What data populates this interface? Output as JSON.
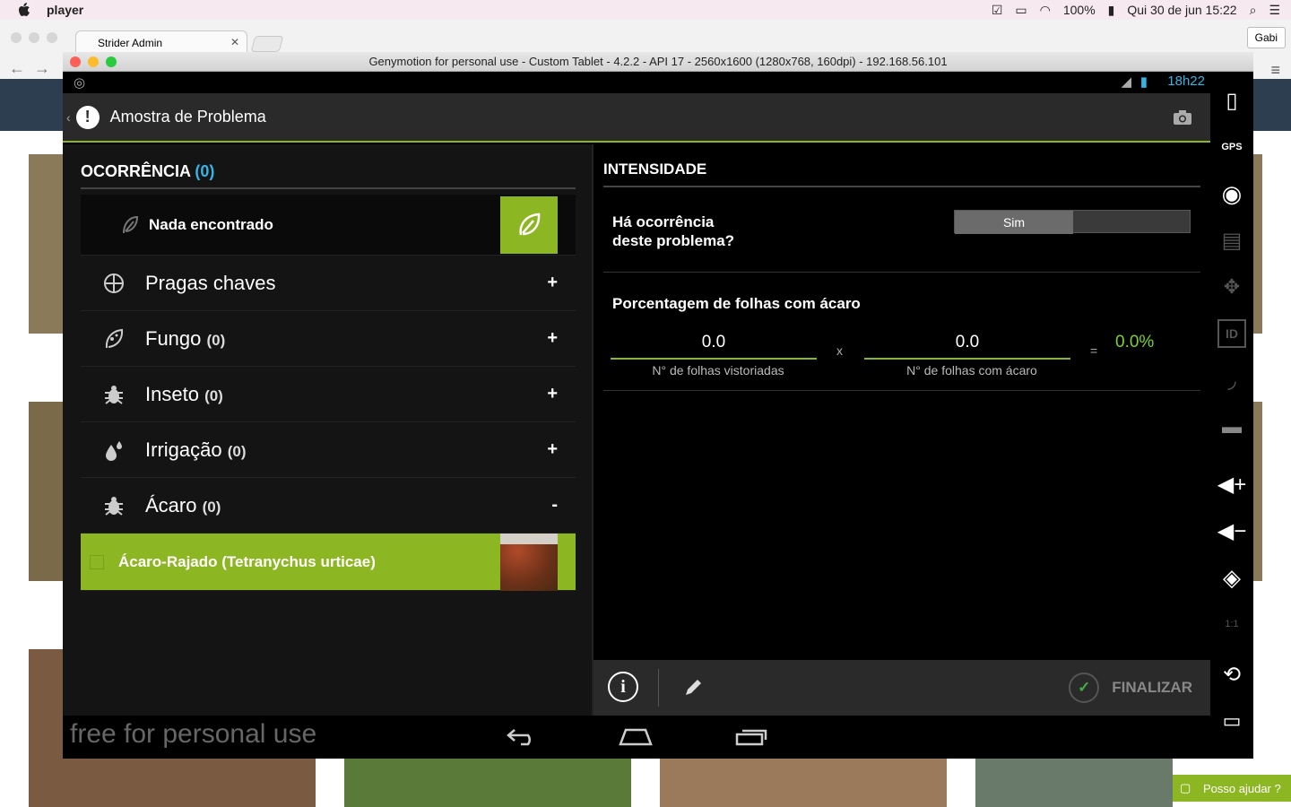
{
  "mac_menubar": {
    "app_name": "player",
    "battery": "100%",
    "datetime": "Qui 30 de jun  15:22"
  },
  "browser": {
    "tab_title": "Strider Admin",
    "profile": "Gabi"
  },
  "genymotion": {
    "title": "Genymotion for personal use - Custom Tablet - 4.2.2 - API 17 - 2560x1600 (1280x768, 160dpi) - 192.168.56.101"
  },
  "android": {
    "status_time": "18h22",
    "actionbar_title": "Amostra de Problema",
    "watermark": "free for personal use"
  },
  "occurrence": {
    "header": "OCORRÊNCIA",
    "header_count": "(0)",
    "nada_label": "Nada encontrado",
    "categories": [
      {
        "label": "Pragas chaves",
        "count": "",
        "sign": "+"
      },
      {
        "label": "Fungo",
        "count": "(0)",
        "sign": "+"
      },
      {
        "label": "Inseto",
        "count": "(0)",
        "sign": "+"
      },
      {
        "label": "Irrigação",
        "count": "(0)",
        "sign": "+"
      },
      {
        "label": "Ácaro",
        "count": "(0)",
        "sign": "-"
      }
    ],
    "selected_item": "Ácaro-Rajado (Tetranychus urticae)"
  },
  "intensity": {
    "header": "INTENSIDADE",
    "question_line1": "Há ocorrência",
    "question_line2": "deste problema?",
    "toggle_on_label": "Sim",
    "pct_title": "Porcentagem de folhas com ácaro",
    "field1_value": "0.0",
    "field1_label": "N° de folhas vistoriadas",
    "op_times": "x",
    "field2_value": "0.0",
    "field2_label": "N° de folhas com ácaro",
    "op_eq": "=",
    "result": "0.0%"
  },
  "bottom": {
    "finalize_label": "FINALIZAR"
  },
  "help_widget": {
    "label": "Posso ajudar ?"
  }
}
